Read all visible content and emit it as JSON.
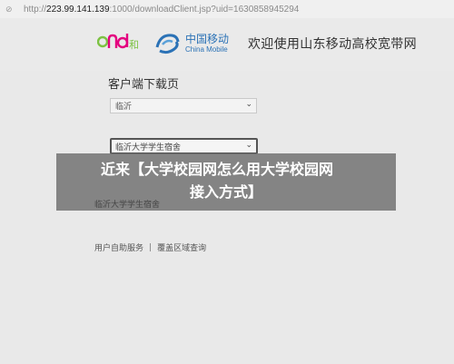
{
  "browser": {
    "security_label": "不安全",
    "url_scheme": "http://",
    "url_host": "223.99.141.139",
    "url_path": ":1000/downloadClient.jsp?uid=1630858945294"
  },
  "header": {
    "and_logo_text": "and和",
    "cmcc_cn": "中国移动",
    "cmcc_en": "China Mobile",
    "welcome": "欢迎使用山东移动高校宽带网"
  },
  "main": {
    "title": "客户端下载页",
    "city_select": "临沂",
    "dorm_select": "临沂大学学生宿舍",
    "selected_name": "临沂大学学生宿舍"
  },
  "overlay": {
    "line1": "近来【大学校园网怎么用大学校园网",
    "line2": "接入方式】"
  },
  "footer": {
    "self_service": "用户自助服务",
    "separator": "|",
    "coverage": "覆盖区域查询"
  },
  "colors": {
    "cmcc_blue": "#2b72b6",
    "and_green": "#7cc242",
    "and_pink": "#e4007f",
    "overlay": "#737373"
  }
}
